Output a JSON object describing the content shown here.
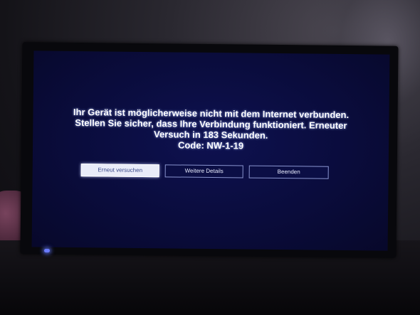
{
  "tv_screen": {
    "message_lines": [
      "Ihr Gerät ist möglicherweise nicht mit dem Internet verbunden.",
      "Stellen Sie sicher, dass Ihre Verbindung funktioniert. Erneuter",
      "Versuch in 183 Sekunden.",
      "Code: NW-1-19"
    ],
    "buttons": {
      "retry": "Erneut versuchen",
      "details": "Weitere Details",
      "quit": "Beenden"
    },
    "selected_button": "retry",
    "colors": {
      "screen_background": "#0a0c3c",
      "text": "#ffffff",
      "button_border": "#8a95d0",
      "selected_button_background": "#e9ecf8",
      "power_led": "#6a7bff"
    }
  }
}
